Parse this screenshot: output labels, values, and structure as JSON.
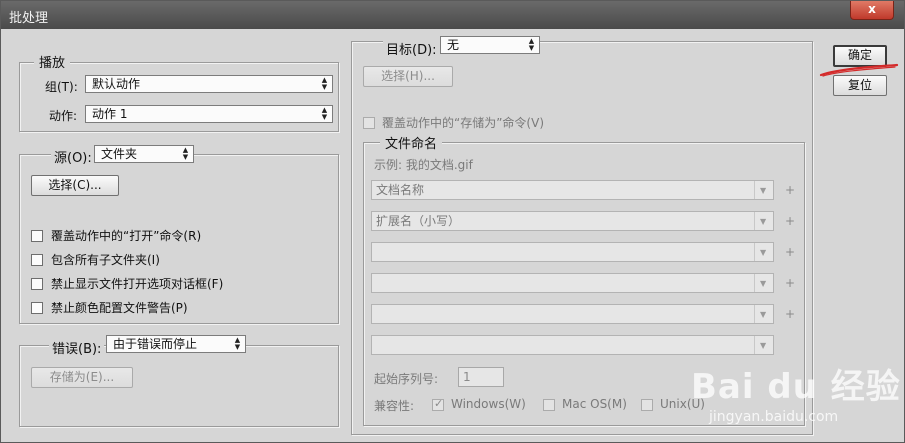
{
  "window": {
    "title": "批处理",
    "close_glyph": "x"
  },
  "play": {
    "legend": "播放",
    "group_label": "组(T):",
    "group_value": "默认动作",
    "action_label": "动作:",
    "action_value": "动作 1"
  },
  "source": {
    "label": "源(O):",
    "value": "文件夹",
    "choose_button": "选择(C)...",
    "checkboxes": [
      {
        "label": "覆盖动作中的“打开”命令(R)",
        "checked": false
      },
      {
        "label": "包含所有子文件夹(I)",
        "checked": false
      },
      {
        "label": "禁止显示文件打开选项对话框(F)",
        "checked": false
      },
      {
        "label": "禁止颜色配置文件警告(P)",
        "checked": false
      }
    ]
  },
  "errors": {
    "label": "错误(B):",
    "value": "由于错误而停止",
    "save_as_button": "存储为(E)..."
  },
  "target": {
    "label": "目标(D):",
    "value": "无",
    "choose_button": "选择(H)...",
    "override_save_as": "覆盖动作中的“存储为”命令(V)"
  },
  "file_naming": {
    "legend": "文件命名",
    "example": "示例: 我的文档.gif",
    "fields": [
      "文档名称",
      "扩展名（小写）",
      "",
      "",
      "",
      ""
    ],
    "plus": "+",
    "start_serial_label": "起始序列号:",
    "start_serial_value": "1",
    "compat_label": "兼容性:",
    "compat": [
      {
        "label": "Windows(W)",
        "checked": true
      },
      {
        "label": "Mac OS(M)",
        "checked": false
      },
      {
        "label": "Unix(U)",
        "checked": false
      }
    ]
  },
  "buttons": {
    "ok": "确定",
    "reset": "复位"
  },
  "watermark": {
    "main": "Bai du 经验",
    "sub": "jingyan.baidu.com"
  },
  "colors": {
    "annotation_red": "#d42a2a",
    "titlebar": "#5a5a5a",
    "dialog_bg": "#d6d6d6"
  }
}
